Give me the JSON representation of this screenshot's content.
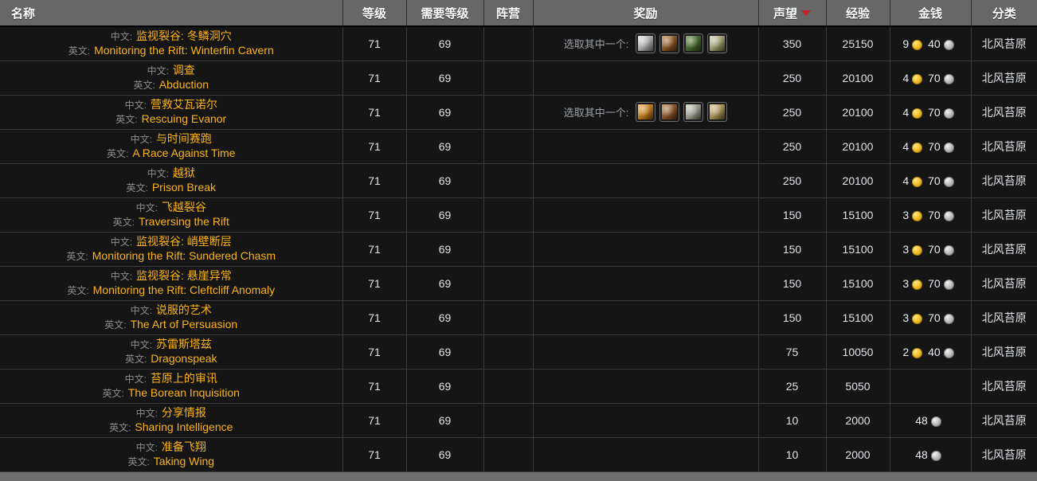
{
  "table": {
    "headers": [
      {
        "key": "name",
        "label": "名称",
        "sorted": false
      },
      {
        "key": "level",
        "label": "等级",
        "sorted": false
      },
      {
        "key": "req_level",
        "label": "需要等级",
        "sorted": false
      },
      {
        "key": "faction",
        "label": "阵营",
        "sorted": false
      },
      {
        "key": "rewards",
        "label": "奖励",
        "sorted": false
      },
      {
        "key": "reputation",
        "label": "声望",
        "sorted": true
      },
      {
        "key": "experience",
        "label": "经验",
        "sorted": false
      },
      {
        "key": "money",
        "label": "金钱",
        "sorted": false
      },
      {
        "key": "category",
        "label": "分类",
        "sorted": false
      }
    ],
    "sort_column": "reputation",
    "sort_direction": "desc",
    "labels": {
      "lang_zh": "中文:",
      "lang_en": "英文:",
      "choose_one": "选取其中一个:"
    },
    "colors": {
      "header_bg": "#676767",
      "row_bg": "#151515",
      "quest_link": "#fcb413",
      "sort_arrow": "#c32020",
      "gold": "#f5c22a",
      "silver": "#c0c0c0"
    },
    "rows": [
      {
        "name_zh": "监视裂谷: 冬鳞洞穴",
        "name_en": "Monitoring the Rift: Winterfin Cavern",
        "level": "71",
        "req_level": "69",
        "faction": "",
        "rewards": {
          "label": "选取其中一个:",
          "icons": [
            {
              "name": "reward-item-cloth-icon",
              "a": "#e8e8e8",
              "b": "#9a9a9a",
              "c": "#3b3b3b"
            },
            {
              "name": "reward-item-leather-icon",
              "a": "#c08a52",
              "b": "#7a4a21",
              "c": "#2e1a0b"
            },
            {
              "name": "reward-item-mail-icon",
              "a": "#6f8f4e",
              "b": "#3e5c25",
              "c": "#18240d"
            },
            {
              "name": "reward-item-plate-icon",
              "a": "#d6d6b8",
              "b": "#8b8b5e",
              "c": "#33331f"
            }
          ]
        },
        "reputation": "350",
        "experience": "25150",
        "money": {
          "gold": "9",
          "silver": "40",
          "copper": ""
        },
        "category": "北风苔原"
      },
      {
        "name_zh": "调查",
        "name_en": "Abduction",
        "level": "71",
        "req_level": "69",
        "faction": "",
        "rewards": {
          "label": "",
          "icons": []
        },
        "reputation": "250",
        "experience": "20100",
        "money": {
          "gold": "4",
          "silver": "70",
          "copper": ""
        },
        "category": "北风苔原"
      },
      {
        "name_zh": "营救艾瓦诺尔",
        "name_en": "Rescuing Evanor",
        "level": "71",
        "req_level": "69",
        "faction": "",
        "rewards": {
          "label": "选取其中一个:",
          "icons": [
            {
              "name": "reward-item-gloves-icon",
              "a": "#f3b24a",
              "b": "#b06c15",
              "c": "#3a2206"
            },
            {
              "name": "reward-item-boots-icon",
              "a": "#c08a52",
              "b": "#7a4a21",
              "c": "#2b1708"
            },
            {
              "name": "reward-item-bracers-icon",
              "a": "#cfd2c4",
              "b": "#8a8d7c",
              "c": "#2d2f26"
            },
            {
              "name": "reward-item-shoulders-icon",
              "a": "#e0c98d",
              "b": "#98824a",
              "c": "#2f2814"
            }
          ]
        },
        "reputation": "250",
        "experience": "20100",
        "money": {
          "gold": "4",
          "silver": "70",
          "copper": ""
        },
        "category": "北风苔原"
      },
      {
        "name_zh": "与时间赛跑",
        "name_en": "A Race Against Time",
        "level": "71",
        "req_level": "69",
        "faction": "",
        "rewards": {
          "label": "",
          "icons": []
        },
        "reputation": "250",
        "experience": "20100",
        "money": {
          "gold": "4",
          "silver": "70",
          "copper": ""
        },
        "category": "北风苔原"
      },
      {
        "name_zh": "越狱",
        "name_en": "Prison Break",
        "level": "71",
        "req_level": "69",
        "faction": "",
        "rewards": {
          "label": "",
          "icons": []
        },
        "reputation": "250",
        "experience": "20100",
        "money": {
          "gold": "4",
          "silver": "70",
          "copper": ""
        },
        "category": "北风苔原"
      },
      {
        "name_zh": "飞越裂谷",
        "name_en": "Traversing the Rift",
        "level": "71",
        "req_level": "69",
        "faction": "",
        "rewards": {
          "label": "",
          "icons": []
        },
        "reputation": "150",
        "experience": "15100",
        "money": {
          "gold": "3",
          "silver": "70",
          "copper": ""
        },
        "category": "北风苔原"
      },
      {
        "name_zh": "监视裂谷: 峭壁断层",
        "name_en": "Monitoring the Rift: Sundered Chasm",
        "level": "71",
        "req_level": "69",
        "faction": "",
        "rewards": {
          "label": "",
          "icons": []
        },
        "reputation": "150",
        "experience": "15100",
        "money": {
          "gold": "3",
          "silver": "70",
          "copper": ""
        },
        "category": "北风苔原"
      },
      {
        "name_zh": "监视裂谷: 悬崖异常",
        "name_en": "Monitoring the Rift: Cleftcliff Anomaly",
        "level": "71",
        "req_level": "69",
        "faction": "",
        "rewards": {
          "label": "",
          "icons": []
        },
        "reputation": "150",
        "experience": "15100",
        "money": {
          "gold": "3",
          "silver": "70",
          "copper": ""
        },
        "category": "北风苔原"
      },
      {
        "name_zh": "说服的艺术",
        "name_en": "The Art of Persuasion",
        "level": "71",
        "req_level": "69",
        "faction": "",
        "rewards": {
          "label": "",
          "icons": []
        },
        "reputation": "150",
        "experience": "15100",
        "money": {
          "gold": "3",
          "silver": "70",
          "copper": ""
        },
        "category": "北风苔原"
      },
      {
        "name_zh": "苏雷斯塔兹",
        "name_en": "Dragonspeak",
        "level": "71",
        "req_level": "69",
        "faction": "",
        "rewards": {
          "label": "",
          "icons": []
        },
        "reputation": "75",
        "experience": "10050",
        "money": {
          "gold": "2",
          "silver": "40",
          "copper": ""
        },
        "category": "北风苔原"
      },
      {
        "name_zh": "苔原上的审讯",
        "name_en": "The Borean Inquisition",
        "level": "71",
        "req_level": "69",
        "faction": "",
        "rewards": {
          "label": "",
          "icons": []
        },
        "reputation": "25",
        "experience": "5050",
        "money": {
          "gold": "",
          "silver": "",
          "copper": ""
        },
        "category": "北风苔原"
      },
      {
        "name_zh": "分享情报",
        "name_en": "Sharing Intelligence",
        "level": "71",
        "req_level": "69",
        "faction": "",
        "rewards": {
          "label": "",
          "icons": []
        },
        "reputation": "10",
        "experience": "2000",
        "money": {
          "gold": "",
          "silver": "48",
          "copper": ""
        },
        "category": "北风苔原"
      },
      {
        "name_zh": "准备飞翔",
        "name_en": "Taking Wing",
        "level": "71",
        "req_level": "69",
        "faction": "",
        "rewards": {
          "label": "",
          "icons": []
        },
        "reputation": "10",
        "experience": "2000",
        "money": {
          "gold": "",
          "silver": "48",
          "copper": ""
        },
        "category": "北风苔原"
      }
    ]
  }
}
